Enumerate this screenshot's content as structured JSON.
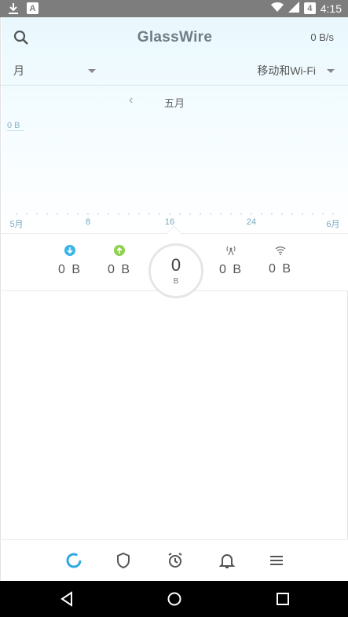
{
  "status_bar": {
    "time": "4:15",
    "battery_level": "4"
  },
  "header": {
    "title": "GlassWire",
    "speed": "0 B/s",
    "search_icon": "search-icon"
  },
  "filters": {
    "period": "月",
    "network": "移动和Wi-Fi"
  },
  "month_nav": {
    "prev": "‹",
    "current": "五月"
  },
  "chart": {
    "y_label": "0 B",
    "x_ticks": [
      "5月",
      "8",
      "16",
      "24",
      "6月"
    ]
  },
  "stats": {
    "download": "0 B",
    "upload": "0 B",
    "total_value": "0",
    "total_unit": "B",
    "mobile": "0 B",
    "wifi": "0 B"
  },
  "colors": {
    "download": "#3cb4e6",
    "upload": "#8fd14f",
    "accent": "#2fa9e0"
  },
  "bottom_nav": [
    "graph-icon",
    "firewall-shield-icon",
    "alarm-clock-icon",
    "bell-icon",
    "menu-icon"
  ],
  "system_nav": [
    "back-icon",
    "home-icon",
    "recents-icon"
  ]
}
